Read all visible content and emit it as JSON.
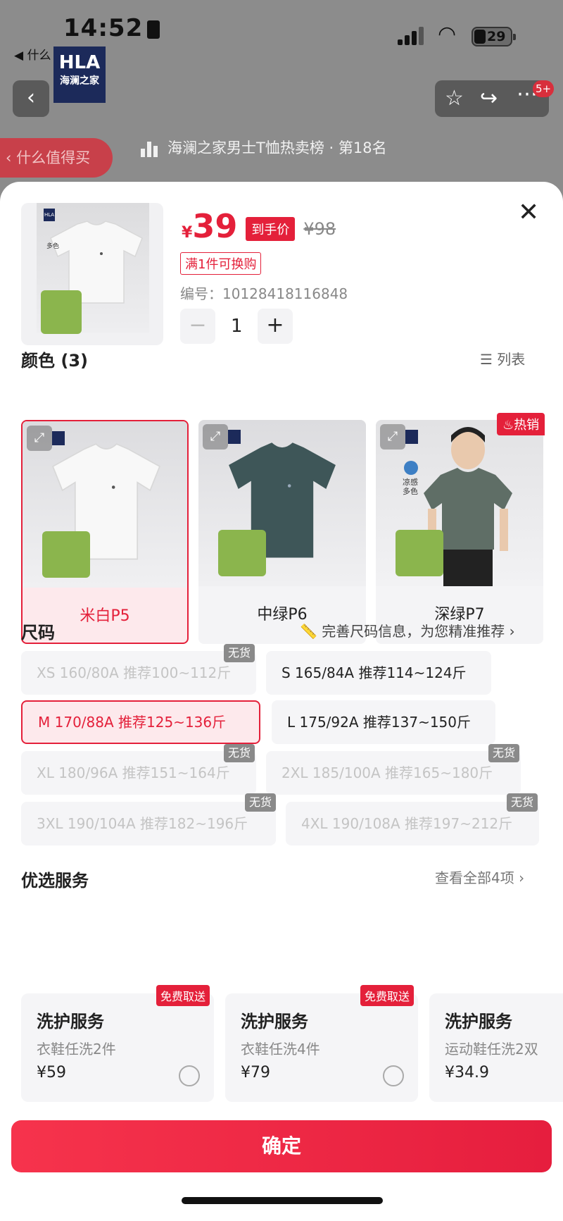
{
  "status_bar": {
    "time": "14:52",
    "back_app": "◀ 什么",
    "battery": "29"
  },
  "background": {
    "logo_line1": "HLA",
    "logo_line2": "海澜之家",
    "notification_count": "5+",
    "worth_buy": "什么值得买",
    "ranking": "海澜之家男士T恤热卖榜 · 第18名"
  },
  "product": {
    "currency": "¥",
    "price": "39",
    "price_tag": "到手价",
    "original_price": "¥98",
    "promo": "满1件可换购",
    "code": "编号：10128418116848",
    "quantity": "1",
    "thumb_brand": "HLA",
    "thumb_color_count": "多色"
  },
  "color_section": {
    "title": "颜色 (3)",
    "list_label": "列表",
    "hot_badge": "热销",
    "options": [
      {
        "label": "米白P5",
        "selected": true,
        "shirt_color": "#f7f7f7"
      },
      {
        "label": "中绿P6",
        "selected": false,
        "shirt_color": "#3e5658"
      },
      {
        "label": "深绿P7",
        "selected": false,
        "shirt_color": "#5f6e66"
      }
    ],
    "model_tag": "凉感",
    "model_tag2": "多色"
  },
  "size_section": {
    "title": "尺码",
    "hint": "完善尺码信息，为您精准推荐",
    "no_stock": "无货",
    "options": [
      {
        "label": "XS 160/80A 推荐100~112斤",
        "available": false
      },
      {
        "label": "S 165/84A 推荐114~124斤",
        "available": true
      },
      {
        "label": "M 170/88A 推荐125~136斤",
        "available": true,
        "selected": true
      },
      {
        "label": "L 175/92A 推荐137~150斤",
        "available": true
      },
      {
        "label": "XL 180/96A 推荐151~164斤",
        "available": false
      },
      {
        "label": "2XL 185/100A 推荐165~180斤",
        "available": false
      },
      {
        "label": "3XL 190/104A 推荐182~196斤",
        "available": false
      },
      {
        "label": "4XL 190/108A 推荐197~212斤",
        "available": false
      }
    ]
  },
  "service_section": {
    "title": "优选服务",
    "view_all": "查看全部4项",
    "free_tag": "免费取送",
    "items": [
      {
        "title": "洗护服务",
        "desc": "衣鞋任洗2件",
        "price": "¥59"
      },
      {
        "title": "洗护服务",
        "desc": "衣鞋任洗4件",
        "price": "¥79"
      },
      {
        "title": "洗护服务",
        "desc": "运动鞋任洗2双",
        "price": "¥34.9"
      }
    ]
  },
  "confirm_label": "确定",
  "colors": {
    "accent": "#e4203a",
    "selected_bg": "#fde9ec"
  }
}
